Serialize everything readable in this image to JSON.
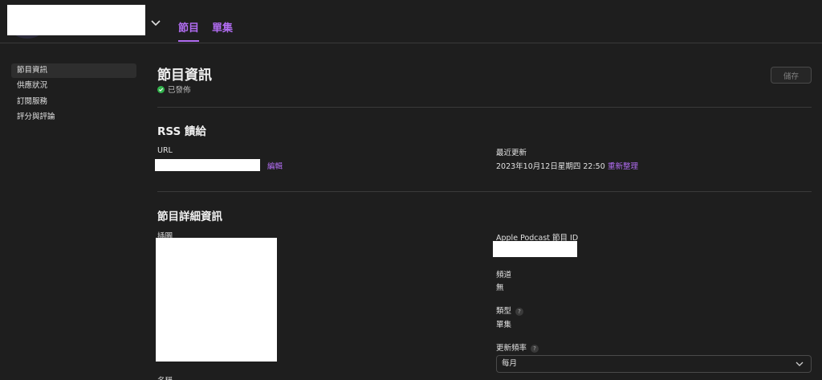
{
  "header": {
    "tabs": [
      {
        "label": "節目"
      },
      {
        "label": "單集"
      }
    ]
  },
  "sidebar": {
    "items": [
      {
        "label": "節目資訊"
      },
      {
        "label": "供應狀況"
      },
      {
        "label": "訂閱服務"
      },
      {
        "label": "評分與評論"
      }
    ]
  },
  "page": {
    "title": "節目資訊",
    "status": "已發佈",
    "save_label": "儲存"
  },
  "rss": {
    "title": "RSS 饋給",
    "url_label": "URL",
    "edit_link": "編輯",
    "last_updated_label": "最近更新",
    "last_updated_value": "2023年10月12日星期四 22:50",
    "refresh_link": "重新整理"
  },
  "details": {
    "title": "節目詳細資訊",
    "artwork_label": "插圖",
    "name_label": "名稱",
    "podcast_id_label": "Apple Podcast 節目 ID",
    "channel_label": "頻道",
    "channel_value": "無",
    "type_label": "類型",
    "type_value": "單集",
    "frequency_label": "更新頻率",
    "frequency_value": "每月",
    "help_glyph": "?"
  }
}
